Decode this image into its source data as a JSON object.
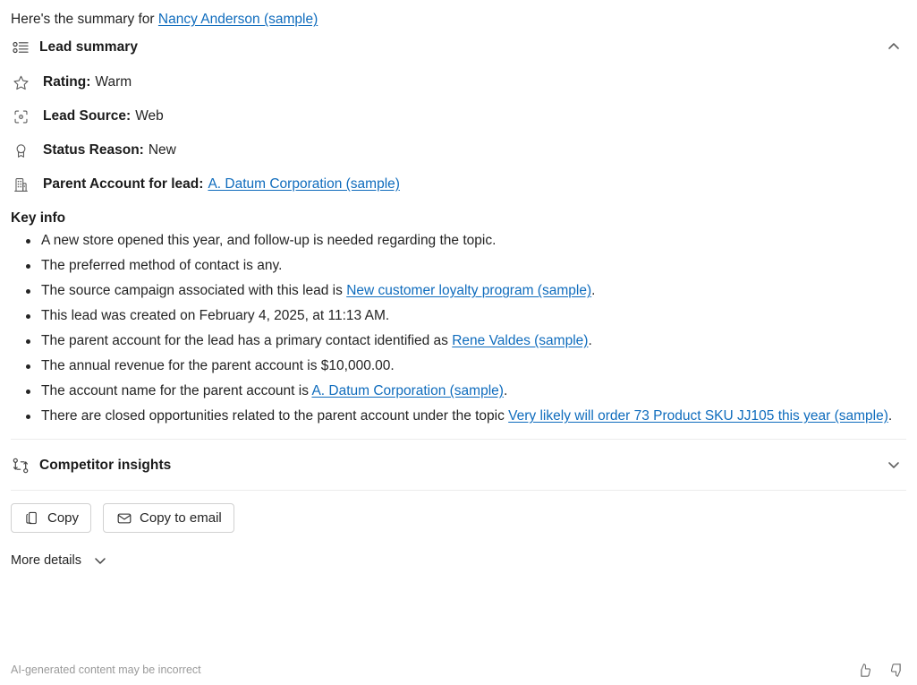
{
  "intro": {
    "prefix": "Here's the summary for ",
    "link": "Nancy Anderson (sample)"
  },
  "lead_summary": {
    "title": "Lead summary",
    "icon": "list-details-icon",
    "expanded": true,
    "toggle_icon": "chevron-up-icon",
    "attributes": [
      {
        "icon": "star-icon",
        "label": "Rating:",
        "value": "Warm",
        "link": null
      },
      {
        "icon": "target-icon",
        "label": "Lead Source:",
        "value": "Web",
        "link": null
      },
      {
        "icon": "ribbon-icon",
        "label": "Status Reason:",
        "value": "New",
        "link": null
      },
      {
        "icon": "building-icon",
        "label": "Parent Account for lead:",
        "value": null,
        "link": "A. Datum Corporation (sample)"
      }
    ]
  },
  "key_info": {
    "title": "Key info",
    "bullets": [
      {
        "parts": [
          {
            "t": "A new store opened this year, and follow-up is needed regarding the topic."
          }
        ]
      },
      {
        "parts": [
          {
            "t": "The preferred method of contact is any."
          }
        ]
      },
      {
        "parts": [
          {
            "t": "The source campaign associated with this lead is "
          },
          {
            "t": "New customer loyalty program (sample)",
            "link": true
          },
          {
            "t": "."
          }
        ]
      },
      {
        "parts": [
          {
            "t": "This lead was created on February 4, 2025, at 11:13 AM."
          }
        ]
      },
      {
        "parts": [
          {
            "t": "The parent account for the lead has a primary contact identified as "
          },
          {
            "t": "Rene Valdes (sample)",
            "link": true
          },
          {
            "t": "."
          }
        ]
      },
      {
        "parts": [
          {
            "t": "The annual revenue for the parent account is $10,000.00."
          }
        ]
      },
      {
        "parts": [
          {
            "t": "The account name for the parent account is "
          },
          {
            "t": "A. Datum Corporation (sample)",
            "link": true
          },
          {
            "t": "."
          }
        ]
      },
      {
        "parts": [
          {
            "t": "There are closed opportunities related to the parent account under the topic "
          },
          {
            "t": "Very likely will order 73 Product SKU JJ105 this year (sample)",
            "link": true
          },
          {
            "t": "."
          }
        ]
      }
    ]
  },
  "competitor_insights": {
    "title": "Competitor insights",
    "icon": "compare-branch-icon",
    "expanded": false,
    "toggle_icon": "chevron-down-icon"
  },
  "actions": {
    "copy_label": "Copy",
    "copy_icon": "copy-icon",
    "copy_to_email_label": "Copy to email",
    "copy_to_email_icon": "mail-icon"
  },
  "more_details": {
    "label": "More details",
    "icon": "chevron-down-icon"
  },
  "footer": {
    "disclaimer": "AI-generated content may be incorrect",
    "thumbs_up_icon": "thumbs-up-icon",
    "thumbs_down_icon": "thumbs-down-icon"
  },
  "colors": {
    "link": "#0f6cbd",
    "text": "#242424",
    "muted": "#9a9a9a",
    "divider": "#ebebeb",
    "icon": "#5a5a5a"
  }
}
